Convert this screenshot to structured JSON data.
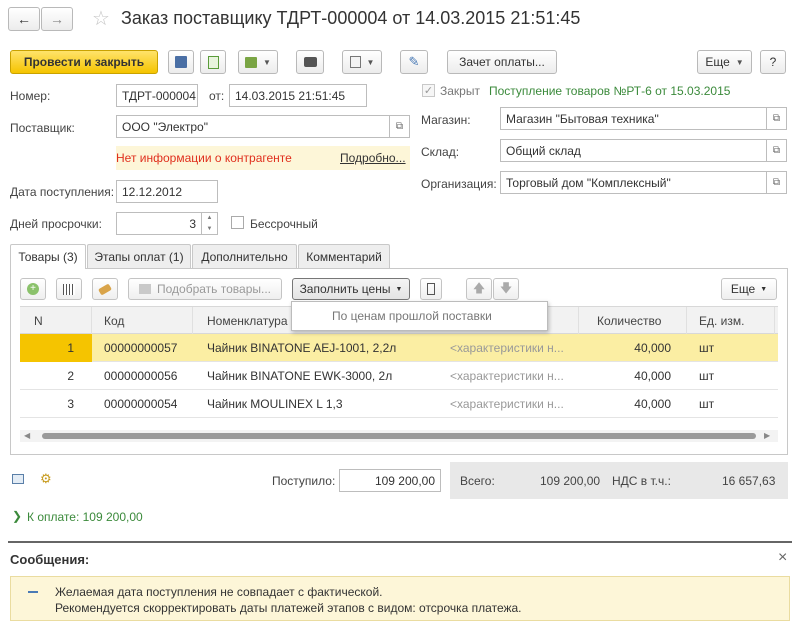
{
  "header": {
    "title": "Заказ поставщику ТДРТ-000004 от 14.03.2015 21:51:45",
    "back_icon": "arrow-left-icon",
    "forward_icon": "arrow-right-icon",
    "star_icon": "star-icon"
  },
  "toolbar": {
    "post_close": "Провести и закрыть",
    "offset_payment": "Зачет оплаты...",
    "more": "Еще",
    "help": "?"
  },
  "form": {
    "number_label": "Номер:",
    "number_value": "ТДРТ-000004",
    "from_label": "от:",
    "date_value": "14.03.2015 21:51:45",
    "supplier_label": "Поставщик:",
    "supplier_value": "ООО \"Электро\"",
    "warning_text": "Нет информации о контрагенте",
    "details_link": "Подробно...",
    "receipt_date_label": "Дата поступления:",
    "receipt_date_value": "12.12.2012",
    "overdue_label": "Дней просрочки:",
    "overdue_value": "3",
    "unlimited_label": "Бессрочный",
    "closed_label": "Закрыт",
    "receipt_link": "Поступление товаров №РТ-6 от 15.03.2015",
    "store_label": "Магазин:",
    "store_value": "Магазин \"Бытовая техника\"",
    "warehouse_label": "Склад:",
    "warehouse_value": "Общий склад",
    "org_label": "Организация:",
    "org_value": "Торговый дом \"Комплексный\""
  },
  "tabs": [
    "Товары (3)",
    "Этапы оплат (1)",
    "Дополнительно",
    "Комментарий"
  ],
  "table_toolbar": {
    "pick_goods": "Подобрать товары...",
    "fill_prices": "Заполнить цены",
    "more": "Еще",
    "dropdown_item": "По ценам прошлой поставки"
  },
  "table": {
    "columns": [
      "N",
      "Код",
      "Номенклатура",
      "Количество",
      "Ед. изм."
    ],
    "rows": [
      {
        "n": "1",
        "code": "00000000057",
        "name": "Чайник BINATONE  AEJ-1001,  2,2л",
        "char": "<характеристики н...",
        "qty": "40,000",
        "unit": "шт"
      },
      {
        "n": "2",
        "code": "00000000056",
        "name": "Чайник BINATONE  EWK-3000,  2л",
        "char": "<характеристики н...",
        "qty": "40,000",
        "unit": "шт"
      },
      {
        "n": "3",
        "code": "00000000054",
        "name": "Чайник MOULINEX L 1,3",
        "char": "<характеристики н...",
        "qty": "40,000",
        "unit": "шт"
      }
    ]
  },
  "totals": {
    "received_label": "Поступило:",
    "received_value": "109 200,00",
    "total_label": "Всего:",
    "total_value": "109 200,00",
    "vat_label": "НДС в т.ч.:",
    "vat_value": "16 657,63"
  },
  "to_pay": "К оплате: 109 200,00",
  "messages": {
    "title": "Сообщения:",
    "close": "×",
    "line1": "Желаемая дата поступления не совпадает с фактической.",
    "line2": "Рекомендуется скорректировать даты платежей этапов с видом: отсрочка платежа."
  },
  "colors": {
    "accent_yellow": "#f5c400",
    "selected_row": "#fbeea3",
    "warning_bg": "#fdf6d8",
    "warning_text": "#e0301e",
    "link_green": "#3b8a3b"
  }
}
